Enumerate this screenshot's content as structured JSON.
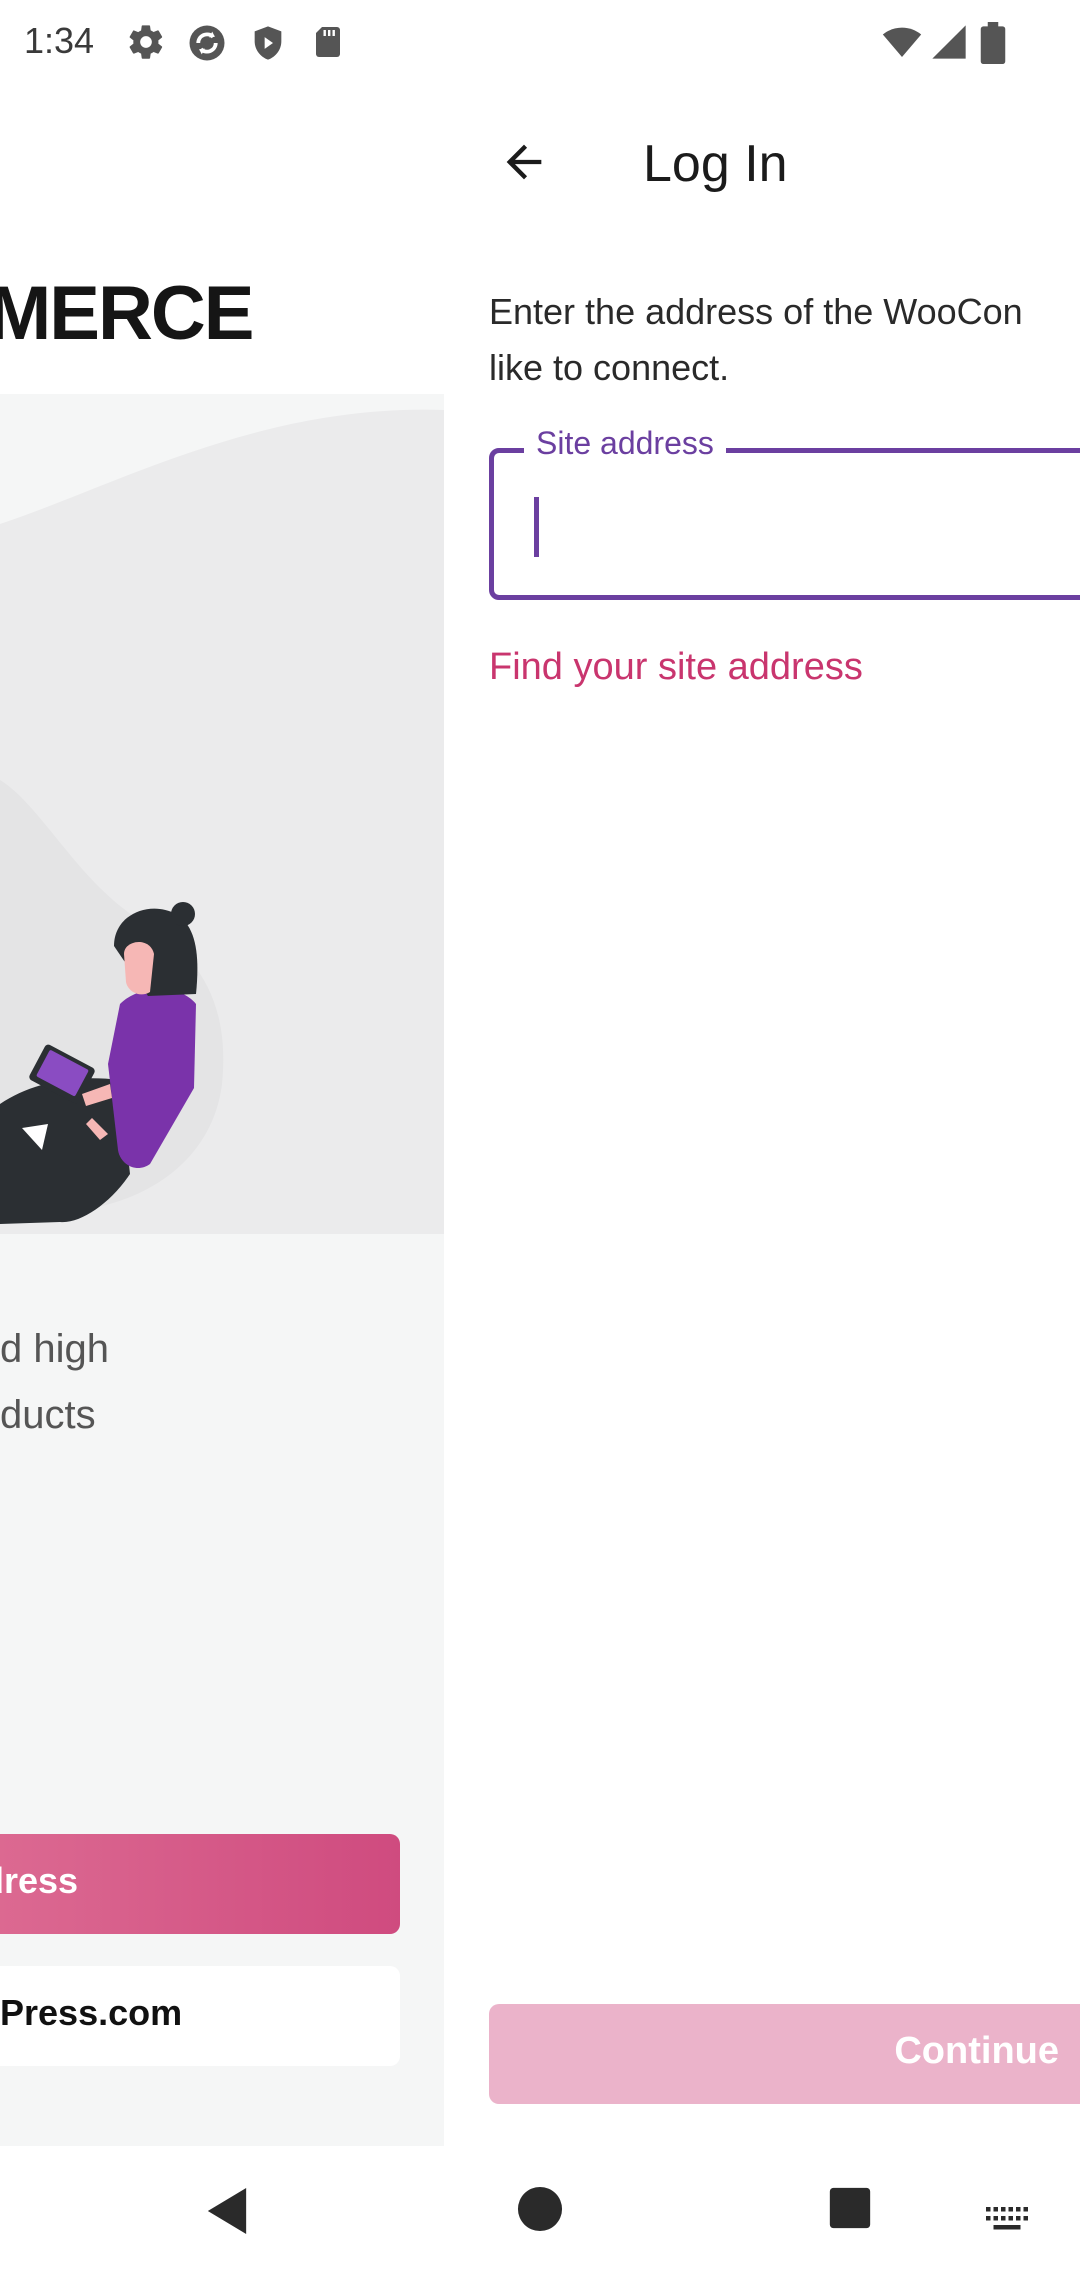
{
  "status_bar": {
    "time": "1:34",
    "left_icons": [
      "gear-icon",
      "sync-icon",
      "shield-icon",
      "sd-card-icon"
    ],
    "right_icons": [
      "wifi-icon",
      "signal-icon",
      "battery-icon"
    ]
  },
  "background_screen": {
    "wordmark": "MERCE",
    "tagline_lines": [
      "d high",
      "ducts"
    ],
    "primary_button_label": "ddress",
    "secondary_button_label": "Press.com",
    "colors": {
      "panel_bg": "#f5f6f6",
      "primary_button": "#d45b88"
    }
  },
  "login_screen": {
    "title": "Log In",
    "instructions": "Enter the address of the WooCom like to connect.",
    "instructions_line1": "Enter the address of the WooCon",
    "instructions_line2": "like to connect.",
    "site_field": {
      "label": "Site address",
      "value": "",
      "placeholder": ""
    },
    "find_site_link": "Find your site address",
    "continue_label": "Continue",
    "colors": {
      "accent": "#6b3fa0",
      "link": "#c9356e",
      "continue_disabled": "#ebb3ca"
    }
  },
  "nav_bar": {
    "items": [
      "back-triangle-icon",
      "home-circle-icon",
      "recents-square-icon",
      "keyboard-icon"
    ]
  }
}
